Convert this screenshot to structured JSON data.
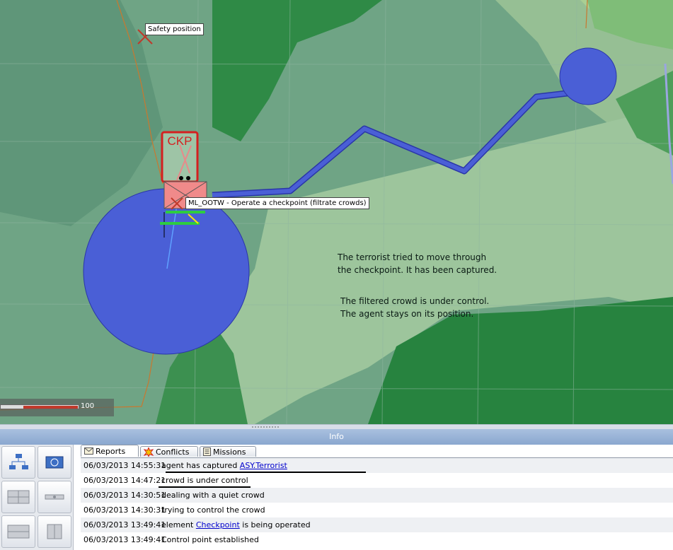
{
  "map": {
    "safety_label": "Safety position",
    "unit_label": "ML_OOTW - Operate a checkpoint (filtrate crowds)",
    "checkpoint_code": "CKP",
    "annotation_1": [
      "The terrorist tried to move through",
      "the checkpoint. It has been captured."
    ],
    "annotation_2": [
      "The filtered crowd is under control.",
      "The agent stays on its position."
    ],
    "scale_value": "100",
    "scale_fill_fraction": 0.71,
    "colors": {
      "route": "#4a5fd6",
      "area": "#4a5fd6",
      "unit": "#f08a8a",
      "checkpoint": "#d42020"
    }
  },
  "info": {
    "title": "Info",
    "tabs": [
      {
        "label": "Reports",
        "icon": "envelope-icon"
      },
      {
        "label": "Conflicts",
        "icon": "explosion-icon"
      },
      {
        "label": "Missions",
        "icon": "document-icon"
      }
    ],
    "toolbox": [
      "hierarchy-icon",
      "map-view-icon",
      "layout-grid-icon",
      "link-icon",
      "horizontal-split-icon",
      "vertical-split-icon"
    ],
    "reports": [
      {
        "time": "06/03/2013 14:55:31",
        "pre": "agent has captured ",
        "link": "ASY.Terrorist",
        "post": ""
      },
      {
        "time": "06/03/2013 14:47:21",
        "pre": "crowd is under control",
        "link": "",
        "post": ""
      },
      {
        "time": "06/03/2013 14:30:51",
        "pre": "dealing with a quiet crowd",
        "link": "",
        "post": ""
      },
      {
        "time": "06/03/2013 14:30:31",
        "pre": "trying to control the crowd",
        "link": "",
        "post": ""
      },
      {
        "time": "06/03/2013 13:49:41",
        "pre": "element ",
        "link": "Checkpoint",
        "post": " is being operated"
      },
      {
        "time": "06/03/2013 13:49:41",
        "pre": "Control point established",
        "link": "",
        "post": ""
      }
    ]
  }
}
